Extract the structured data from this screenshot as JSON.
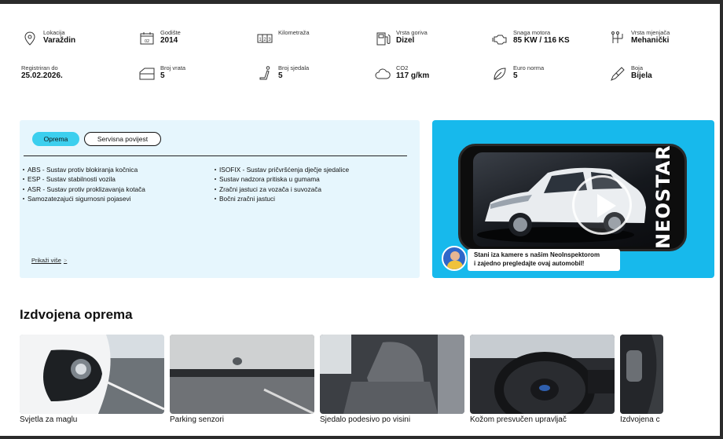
{
  "specs": [
    {
      "label": "Lokacija",
      "value": "Varaždin",
      "icon": "location-pin-icon"
    },
    {
      "label": "Godište",
      "value": "2014",
      "icon": "calendar-icon"
    },
    {
      "label": "Kilometraža",
      "value": "",
      "icon": "odometer-icon"
    },
    {
      "label": "Vrsta goriva",
      "value": "Dizel",
      "icon": "fuel-pump-icon"
    },
    {
      "label": "Snaga motora",
      "value": "85 KW / 116 KS",
      "icon": "engine-icon"
    },
    {
      "label": "Vrsta mjenjača",
      "value": "Mehanički",
      "icon": "gearbox-icon"
    },
    {
      "label": "Registriran do",
      "value": "25.02.2026.",
      "icon": ""
    },
    {
      "label": "Broj vrata",
      "value": "5",
      "icon": "car-door-icon"
    },
    {
      "label": "Broj sjedala",
      "value": "5",
      "icon": "seat-icon"
    },
    {
      "label": "CO2",
      "value": "117 g/km",
      "icon": "cloud-icon"
    },
    {
      "label": "Euro norma",
      "value": "5",
      "icon": "leaf-icon"
    },
    {
      "label": "Boja",
      "value": "Bijela",
      "icon": "paint-brush-icon"
    }
  ],
  "calendar_day": "02",
  "equipment": {
    "tabs": [
      "Oprema",
      "Servisna povijest"
    ],
    "col1": [
      "ABS - Sustav protiv blokiranja kočnica",
      "ESP - Sustav stabilnosti vozila",
      "ASR - Sustav protiv proklizavanja kotača",
      "Samozatezajući sigurnosni pojasevi"
    ],
    "col2": [
      "ISOFIX - Sustav pričvršćenja dječje sjedalice",
      "Sustav nadzora pritiska u gumama",
      "Zračni jastuci za vozača i suvozača",
      "Bočni zračni jastuci"
    ],
    "show_more": "Prikaži više",
    "show_more_arrow": ">"
  },
  "video": {
    "brand": "NEOSTAR",
    "callout_line1": "Stani iza kamere s našim NeoInspektorom",
    "callout_line2": "i zajedno pregledajte ovaj automobil!"
  },
  "featured": {
    "title": "Izdvojena oprema",
    "items": [
      "Svjetla za maglu",
      "Parking senzori",
      "Sjedalo podesivo po visini",
      "Kožom presvučen upravljač",
      "Izdvojena c"
    ]
  },
  "colors": {
    "accent": "#3ccfee",
    "panel": "#e6f6fd",
    "video_bg": "#17b9ec"
  }
}
